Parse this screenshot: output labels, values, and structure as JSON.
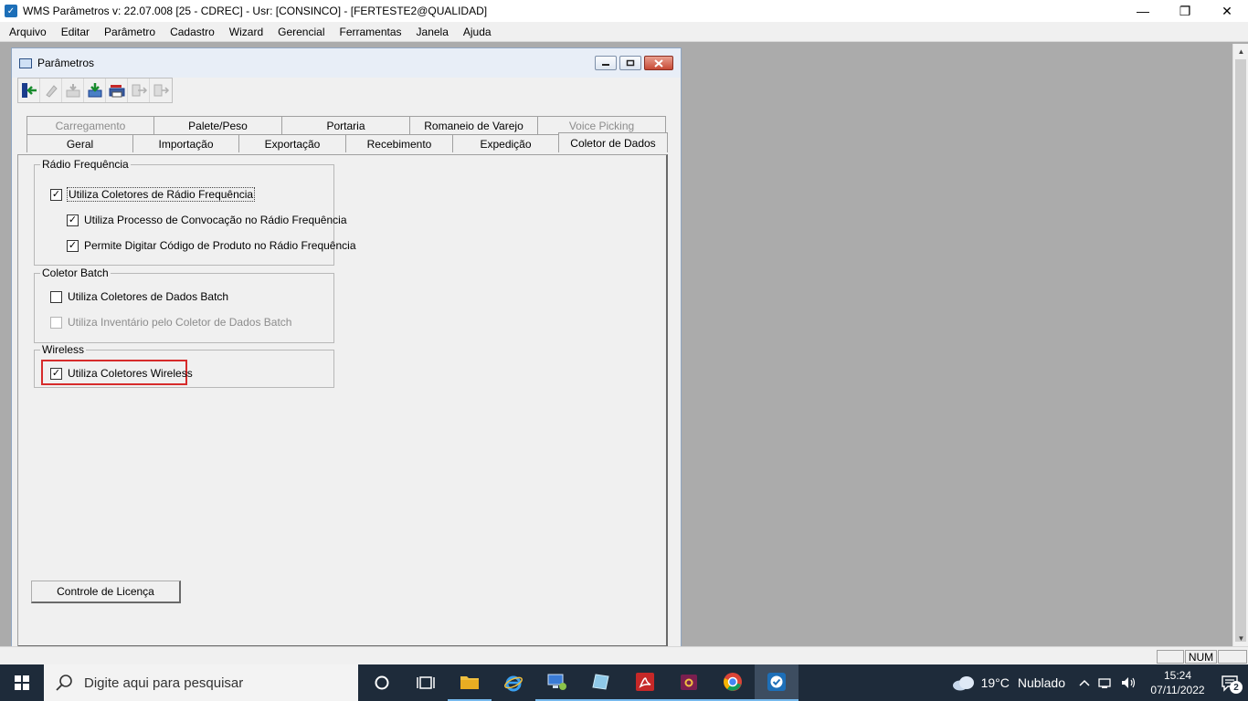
{
  "titlebar": {
    "title": "WMS Parâmetros  v: 22.07.008   [25 - CDREC] - Usr: [CONSINCO] - [FERTESTE2@QUALIDAD]",
    "minimize": "—",
    "maximize": "❐",
    "close": "✕"
  },
  "menu": [
    "Arquivo",
    "Editar",
    "Parâmetro",
    "Cadastro",
    "Wizard",
    "Gerencial",
    "Ferramentas",
    "Janela",
    "Ajuda"
  ],
  "child_window": {
    "title": "Parâmetros"
  },
  "tabs": {
    "row_top": [
      "Carregamento",
      "Palete/Peso",
      "Portaria",
      "Romaneio de Varejo",
      "Voice Picking"
    ],
    "row_bottom": [
      "Geral",
      "Importação",
      "Exportação",
      "Recebimento",
      "Expedição",
      "Coletor de Dados"
    ],
    "active": "Coletor de Dados"
  },
  "groups": {
    "radio": {
      "label": "Rádio Frequência",
      "items": [
        {
          "label": "Utiliza Coletores de Rádio Frequência",
          "checked": true,
          "enabled": true
        },
        {
          "label": "Utiliza Processo de Convocação no Rádio Frequência",
          "checked": true,
          "enabled": true
        },
        {
          "label": "Permite Digitar Código de Produto no Rádio Frequência",
          "checked": true,
          "enabled": true
        }
      ]
    },
    "batch": {
      "label": "Coletor Batch",
      "items": [
        {
          "label": "Utiliza Coletores de Dados Batch",
          "checked": false,
          "enabled": true
        },
        {
          "label": "Utiliza Inventário pelo Coletor de Dados Batch",
          "checked": false,
          "enabled": false
        }
      ]
    },
    "wireless": {
      "label": "Wireless",
      "items": [
        {
          "label": "Utiliza Coletores Wireless",
          "checked": true,
          "enabled": true
        }
      ]
    }
  },
  "buttons": {
    "license": "Controle de Licença"
  },
  "statusbar": {
    "num": "NUM"
  },
  "taskbar": {
    "search_placeholder": "Digite aqui para pesquisar",
    "weather_temp": "19°C",
    "weather_desc": "Nublado",
    "time": "15:24",
    "date": "07/11/2022",
    "notifications": "2"
  },
  "colors": {
    "highlight": "#d62b2b",
    "taskbar_bg": "#1e2b3a",
    "mdi_bg": "#ababab"
  }
}
